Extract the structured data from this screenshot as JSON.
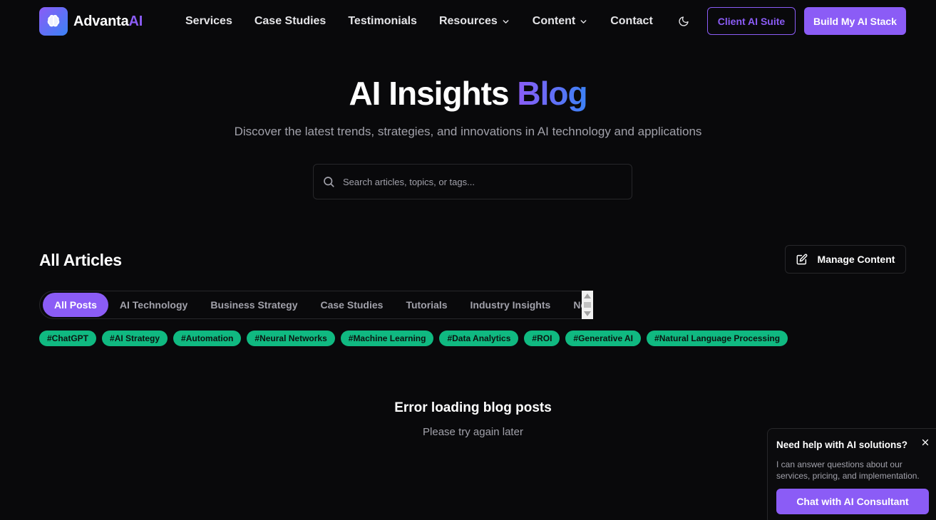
{
  "brand": {
    "name_main": "Advanta",
    "name_accent": "AI",
    "icon": "brain-icon"
  },
  "nav": {
    "links": [
      {
        "label": "Services",
        "dropdown": false
      },
      {
        "label": "Case Studies",
        "dropdown": false
      },
      {
        "label": "Testimonials",
        "dropdown": false
      },
      {
        "label": "Resources",
        "dropdown": true
      },
      {
        "label": "Content",
        "dropdown": true
      },
      {
        "label": "Contact",
        "dropdown": false
      }
    ],
    "theme_icon": "moon-icon",
    "client_suite_label": "Client AI Suite",
    "build_stack_label": "Build My AI Stack"
  },
  "hero": {
    "title_main": "AI Insights ",
    "title_accent": "Blog",
    "subtitle": "Discover the latest trends, strategies, and innovations in AI technology and applications",
    "search_placeholder": "Search articles, topics, or tags..."
  },
  "articles": {
    "heading": "All Articles",
    "manage_label": "Manage Content",
    "tabs": [
      "All Posts",
      "AI Technology",
      "Business Strategy",
      "Case Studies",
      "Tutorials",
      "Industry Insights",
      "News"
    ],
    "active_tab": "All Posts",
    "tags": [
      "#ChatGPT",
      "#AI Strategy",
      "#Automation",
      "#Neural Networks",
      "#Machine Learning",
      "#Data Analytics",
      "#ROI",
      "#Generative AI",
      "#Natural Language Processing"
    ],
    "error_title": "Error loading blog posts",
    "error_subtitle": "Please try again later"
  },
  "chat": {
    "title": "Need help with AI solutions?",
    "body": "I can answer questions about our services, pricing, and implementation.",
    "button_label": "Chat with AI Consultant"
  },
  "colors": {
    "accent": "#8b5cf6",
    "accent_blue": "#3b82f6",
    "tag_green": "#10b981",
    "background": "#09090b"
  }
}
